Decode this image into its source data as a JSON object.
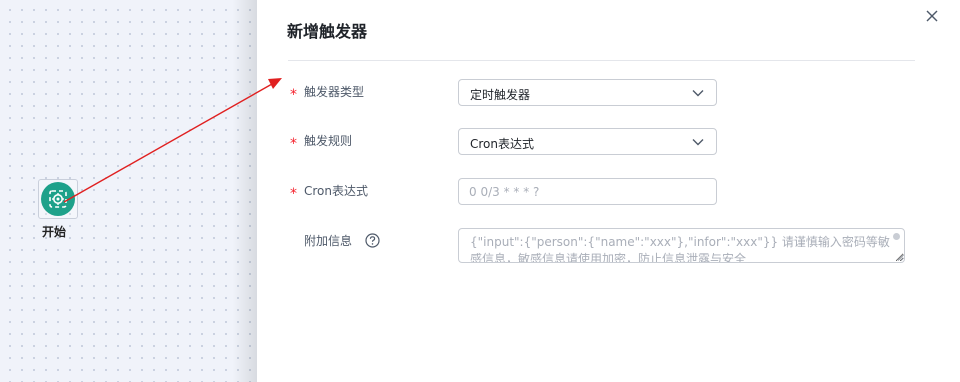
{
  "canvas": {
    "start_node": {
      "label": "开始",
      "icon": "flow-start-icon",
      "color": "#1ea18a"
    },
    "connector_color": "#e02020"
  },
  "drawer": {
    "title": "新增触发器",
    "close_icon": "close-icon",
    "fields": [
      {
        "label": "触发器类型",
        "required": "*",
        "value": "定时触发器",
        "type": "select"
      },
      {
        "label": "触发规则",
        "required": "*",
        "value": "Cron表达式",
        "type": "select"
      },
      {
        "label": "Cron表达式",
        "required": "*",
        "value": "",
        "placeholder": "0 0/3 * * * ?",
        "type": "input"
      },
      {
        "label": "附加信息",
        "required": "",
        "value": "",
        "placeholder": "{\"input\":{\"person\":{\"name\":\"xxx\"},\"infor\":\"xxx\"}} 请谨慎输入密码等敏感信息，敏感信息请使用加密，防止信息泄露与安全",
        "type": "textarea",
        "help_icon": "question-circle-icon"
      }
    ]
  }
}
